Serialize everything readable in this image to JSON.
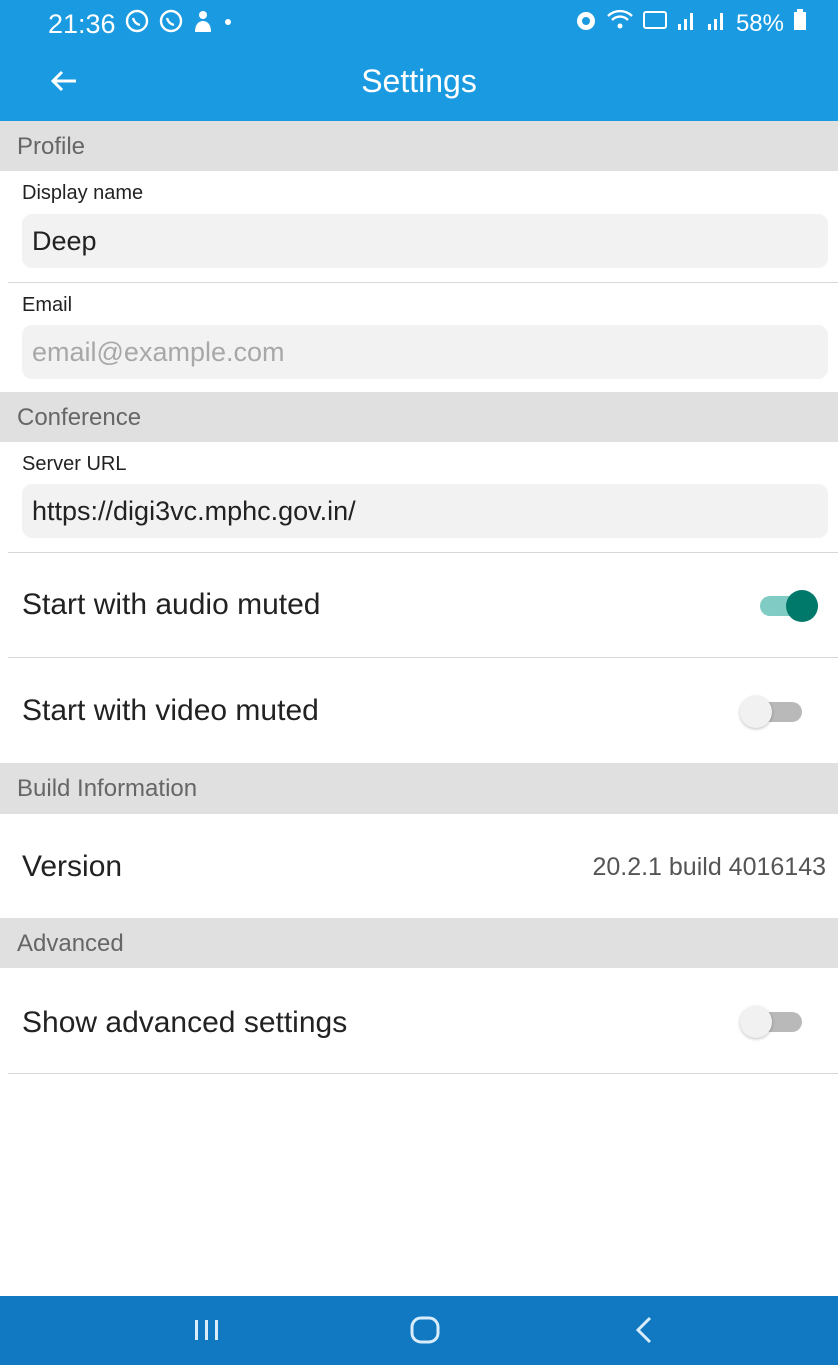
{
  "status_bar": {
    "time": "21:36",
    "battery": "58%",
    "icons_left": [
      "whatsapp-icon",
      "whatsapp-icon",
      "notification-icon",
      "dot-icon"
    ],
    "icons_right": [
      "alarm-icon",
      "wifi-icon",
      "volte-icon",
      "signal-icon",
      "signal-icon",
      "battery-icon"
    ]
  },
  "app_bar": {
    "title": "Settings",
    "back_icon": "arrow-back-icon"
  },
  "sections": {
    "profile": "Profile",
    "conference": "Conference",
    "build_information": "Build Information",
    "advanced": "Advanced"
  },
  "profile": {
    "display_name_label": "Display name",
    "display_name_value": "Deep",
    "email_label": "Email",
    "email_placeholder": "email@example.com"
  },
  "conference": {
    "server_url_label": "Server URL",
    "server_url_value": "https://digi3vc.mphc.gov.in/",
    "audio_muted_label": "Start with audio muted",
    "audio_muted": true,
    "video_muted_label": "Start with video muted",
    "video_muted": false
  },
  "build": {
    "version_label": "Version",
    "version_value": "20.2.1 build 4016143"
  },
  "advanced": {
    "show_advanced_label": "Show advanced settings",
    "show_advanced": false
  },
  "colors": {
    "accent": "#1a9ae0",
    "nav_bar": "#1179c2",
    "toggle_on_thumb": "#00796b",
    "toggle_on_track": "#80cbc4",
    "toggle_off_thumb": "#f1f1f1",
    "toggle_off_track": "#b9b9b9"
  },
  "nav_bar": {
    "recents_icon": "recents-icon",
    "home_icon": "home-icon",
    "back_icon": "back-chevron-icon"
  }
}
